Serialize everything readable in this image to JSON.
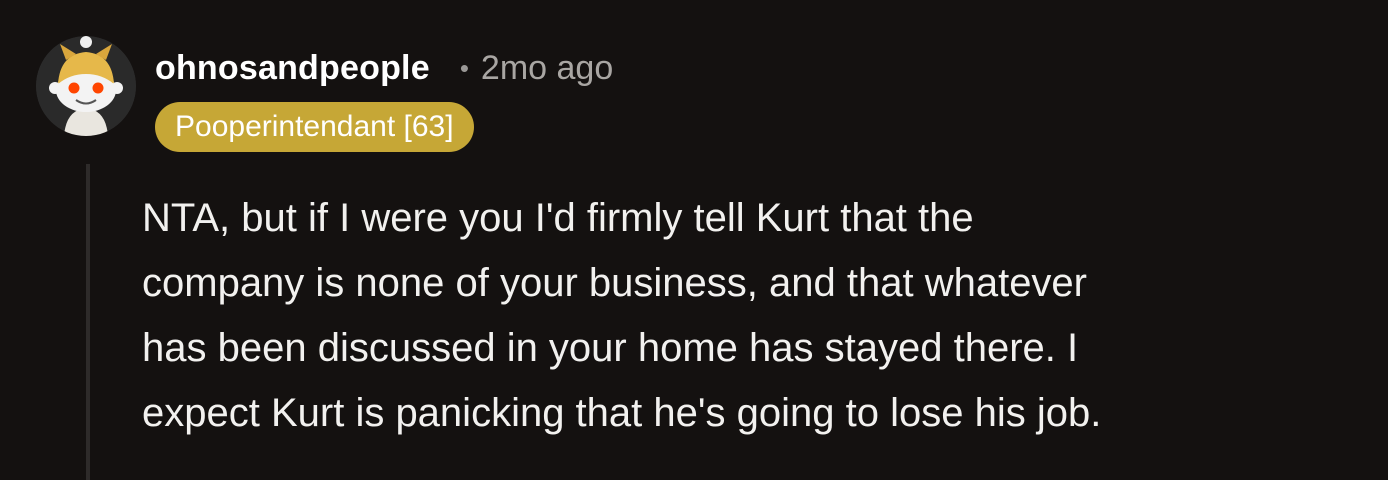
{
  "comment": {
    "username": "ohnosandpeople",
    "separator": "•",
    "timestamp": "2mo ago",
    "flair": "Pooperintendant [63]",
    "body_lines": [
      "NTA, but if I were you I'd firmly tell Kurt that the",
      "company is none of your business, and that whatever",
      "has been discussed in your home has stayed there. I",
      "expect Kurt is panicking that he's going to lose his job."
    ]
  },
  "colors": {
    "background": "#141110",
    "flair": "#c6a736",
    "thread_line": "#2e2b2a",
    "text": "#f2f1ef",
    "meta": "#a9a6a3"
  },
  "avatar": {
    "icon": "snoo-avatar-icon"
  }
}
